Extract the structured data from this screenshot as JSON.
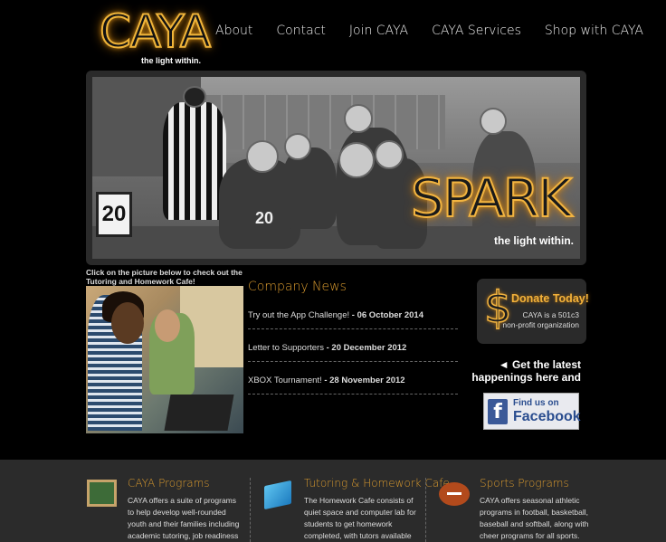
{
  "header": {
    "logo_text": "CAYA",
    "logo_tagline": "the light within.",
    "nav": [
      "About",
      "Contact",
      "Join CAYA",
      "CAYA Services",
      "Shop with CAYA"
    ]
  },
  "banner": {
    "headline": "SPARK",
    "tagline": "the light within.",
    "scoreboard": "20",
    "jersey_numbers": [
      "20"
    ]
  },
  "cafe": {
    "caption": "Click on the picture below to check out the Tutoring and Homework Cafe!"
  },
  "news": {
    "title": "Company News",
    "items": [
      {
        "text": "Try out the App Challenge!",
        "date": "06 October 2014"
      },
      {
        "text": "Letter to Supporters",
        "date": "20 December 2012"
      },
      {
        "text": "XBOX Tournament!",
        "date": "28 November 2012"
      }
    ]
  },
  "donate": {
    "symbol": "$",
    "title": "Donate Today!",
    "sub1": "CAYA is a 501c3",
    "sub2": "non-profit organization"
  },
  "social": {
    "line1": "◄ Get the latest",
    "line2": "happenings here and",
    "fb_small": "Find us on",
    "fb_big": "Facebook",
    "fb_letter": "f"
  },
  "footer": {
    "cols": [
      {
        "title": "CAYA Programs",
        "icon": "chalkboard-icon",
        "body": "CAYA offers a suite of programs to help develop well-rounded youth and their families including academic tutoring, job readiness training,"
      },
      {
        "title": "Tutoring & Homework Cafe",
        "icon": "book-icon",
        "body": "The Homework Cafe consists of quiet space and computer lab for students to get homework completed, with tutors available to assist the students."
      },
      {
        "title": "Sports Programs",
        "icon": "football-icon",
        "body": "CAYA offers seasonal athletic programs in football, basketball, baseball and softball, along with cheer programs for all sports."
      }
    ]
  },
  "colors": {
    "accent": "#d99a2e",
    "background": "#000000",
    "footer_bg": "#2b2b2b",
    "facebook": "#3b5998"
  }
}
